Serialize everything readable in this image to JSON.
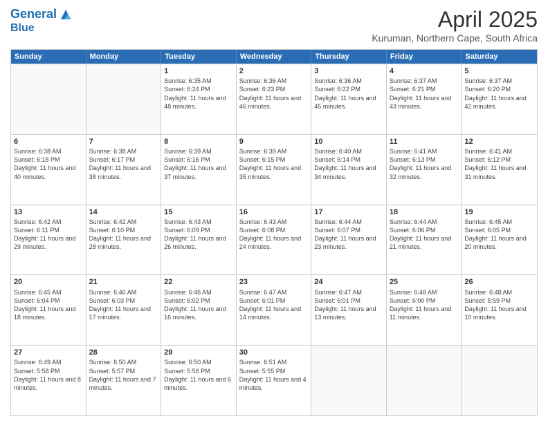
{
  "header": {
    "logo_line1": "General",
    "logo_line2": "Blue",
    "month": "April 2025",
    "location": "Kuruman, Northern Cape, South Africa"
  },
  "weekdays": [
    "Sunday",
    "Monday",
    "Tuesday",
    "Wednesday",
    "Thursday",
    "Friday",
    "Saturday"
  ],
  "rows": [
    [
      {
        "day": "",
        "empty": true
      },
      {
        "day": "",
        "empty": true
      },
      {
        "day": "1",
        "sunrise": "Sunrise: 6:35 AM",
        "sunset": "Sunset: 6:24 PM",
        "daylight": "Daylight: 11 hours and 48 minutes."
      },
      {
        "day": "2",
        "sunrise": "Sunrise: 6:36 AM",
        "sunset": "Sunset: 6:23 PM",
        "daylight": "Daylight: 11 hours and 46 minutes."
      },
      {
        "day": "3",
        "sunrise": "Sunrise: 6:36 AM",
        "sunset": "Sunset: 6:22 PM",
        "daylight": "Daylight: 11 hours and 45 minutes."
      },
      {
        "day": "4",
        "sunrise": "Sunrise: 6:37 AM",
        "sunset": "Sunset: 6:21 PM",
        "daylight": "Daylight: 11 hours and 43 minutes."
      },
      {
        "day": "5",
        "sunrise": "Sunrise: 6:37 AM",
        "sunset": "Sunset: 6:20 PM",
        "daylight": "Daylight: 11 hours and 42 minutes."
      }
    ],
    [
      {
        "day": "6",
        "sunrise": "Sunrise: 6:38 AM",
        "sunset": "Sunset: 6:18 PM",
        "daylight": "Daylight: 11 hours and 40 minutes."
      },
      {
        "day": "7",
        "sunrise": "Sunrise: 6:38 AM",
        "sunset": "Sunset: 6:17 PM",
        "daylight": "Daylight: 11 hours and 38 minutes."
      },
      {
        "day": "8",
        "sunrise": "Sunrise: 6:39 AM",
        "sunset": "Sunset: 6:16 PM",
        "daylight": "Daylight: 11 hours and 37 minutes."
      },
      {
        "day": "9",
        "sunrise": "Sunrise: 6:39 AM",
        "sunset": "Sunset: 6:15 PM",
        "daylight": "Daylight: 11 hours and 35 minutes."
      },
      {
        "day": "10",
        "sunrise": "Sunrise: 6:40 AM",
        "sunset": "Sunset: 6:14 PM",
        "daylight": "Daylight: 11 hours and 34 minutes."
      },
      {
        "day": "11",
        "sunrise": "Sunrise: 6:41 AM",
        "sunset": "Sunset: 6:13 PM",
        "daylight": "Daylight: 11 hours and 32 minutes."
      },
      {
        "day": "12",
        "sunrise": "Sunrise: 6:41 AM",
        "sunset": "Sunset: 6:12 PM",
        "daylight": "Daylight: 11 hours and 31 minutes."
      }
    ],
    [
      {
        "day": "13",
        "sunrise": "Sunrise: 6:42 AM",
        "sunset": "Sunset: 6:11 PM",
        "daylight": "Daylight: 11 hours and 29 minutes."
      },
      {
        "day": "14",
        "sunrise": "Sunrise: 6:42 AM",
        "sunset": "Sunset: 6:10 PM",
        "daylight": "Daylight: 11 hours and 28 minutes."
      },
      {
        "day": "15",
        "sunrise": "Sunrise: 6:43 AM",
        "sunset": "Sunset: 6:09 PM",
        "daylight": "Daylight: 11 hours and 26 minutes."
      },
      {
        "day": "16",
        "sunrise": "Sunrise: 6:43 AM",
        "sunset": "Sunset: 6:08 PM",
        "daylight": "Daylight: 11 hours and 24 minutes."
      },
      {
        "day": "17",
        "sunrise": "Sunrise: 6:44 AM",
        "sunset": "Sunset: 6:07 PM",
        "daylight": "Daylight: 11 hours and 23 minutes."
      },
      {
        "day": "18",
        "sunrise": "Sunrise: 6:44 AM",
        "sunset": "Sunset: 6:06 PM",
        "daylight": "Daylight: 11 hours and 21 minutes."
      },
      {
        "day": "19",
        "sunrise": "Sunrise: 6:45 AM",
        "sunset": "Sunset: 6:05 PM",
        "daylight": "Daylight: 11 hours and 20 minutes."
      }
    ],
    [
      {
        "day": "20",
        "sunrise": "Sunrise: 6:45 AM",
        "sunset": "Sunset: 6:04 PM",
        "daylight": "Daylight: 11 hours and 18 minutes."
      },
      {
        "day": "21",
        "sunrise": "Sunrise: 6:46 AM",
        "sunset": "Sunset: 6:03 PM",
        "daylight": "Daylight: 11 hours and 17 minutes."
      },
      {
        "day": "22",
        "sunrise": "Sunrise: 6:46 AM",
        "sunset": "Sunset: 6:02 PM",
        "daylight": "Daylight: 11 hours and 16 minutes."
      },
      {
        "day": "23",
        "sunrise": "Sunrise: 6:47 AM",
        "sunset": "Sunset: 6:01 PM",
        "daylight": "Daylight: 11 hours and 14 minutes."
      },
      {
        "day": "24",
        "sunrise": "Sunrise: 6:47 AM",
        "sunset": "Sunset: 6:01 PM",
        "daylight": "Daylight: 11 hours and 13 minutes."
      },
      {
        "day": "25",
        "sunrise": "Sunrise: 6:48 AM",
        "sunset": "Sunset: 6:00 PM",
        "daylight": "Daylight: 11 hours and 11 minutes."
      },
      {
        "day": "26",
        "sunrise": "Sunrise: 6:48 AM",
        "sunset": "Sunset: 5:59 PM",
        "daylight": "Daylight: 11 hours and 10 minutes."
      }
    ],
    [
      {
        "day": "27",
        "sunrise": "Sunrise: 6:49 AM",
        "sunset": "Sunset: 5:58 PM",
        "daylight": "Daylight: 11 hours and 8 minutes."
      },
      {
        "day": "28",
        "sunrise": "Sunrise: 6:50 AM",
        "sunset": "Sunset: 5:57 PM",
        "daylight": "Daylight: 11 hours and 7 minutes."
      },
      {
        "day": "29",
        "sunrise": "Sunrise: 6:50 AM",
        "sunset": "Sunset: 5:56 PM",
        "daylight": "Daylight: 11 hours and 6 minutes."
      },
      {
        "day": "30",
        "sunrise": "Sunrise: 6:51 AM",
        "sunset": "Sunset: 5:55 PM",
        "daylight": "Daylight: 11 hours and 4 minutes."
      },
      {
        "day": "",
        "empty": true
      },
      {
        "day": "",
        "empty": true
      },
      {
        "day": "",
        "empty": true
      }
    ]
  ]
}
